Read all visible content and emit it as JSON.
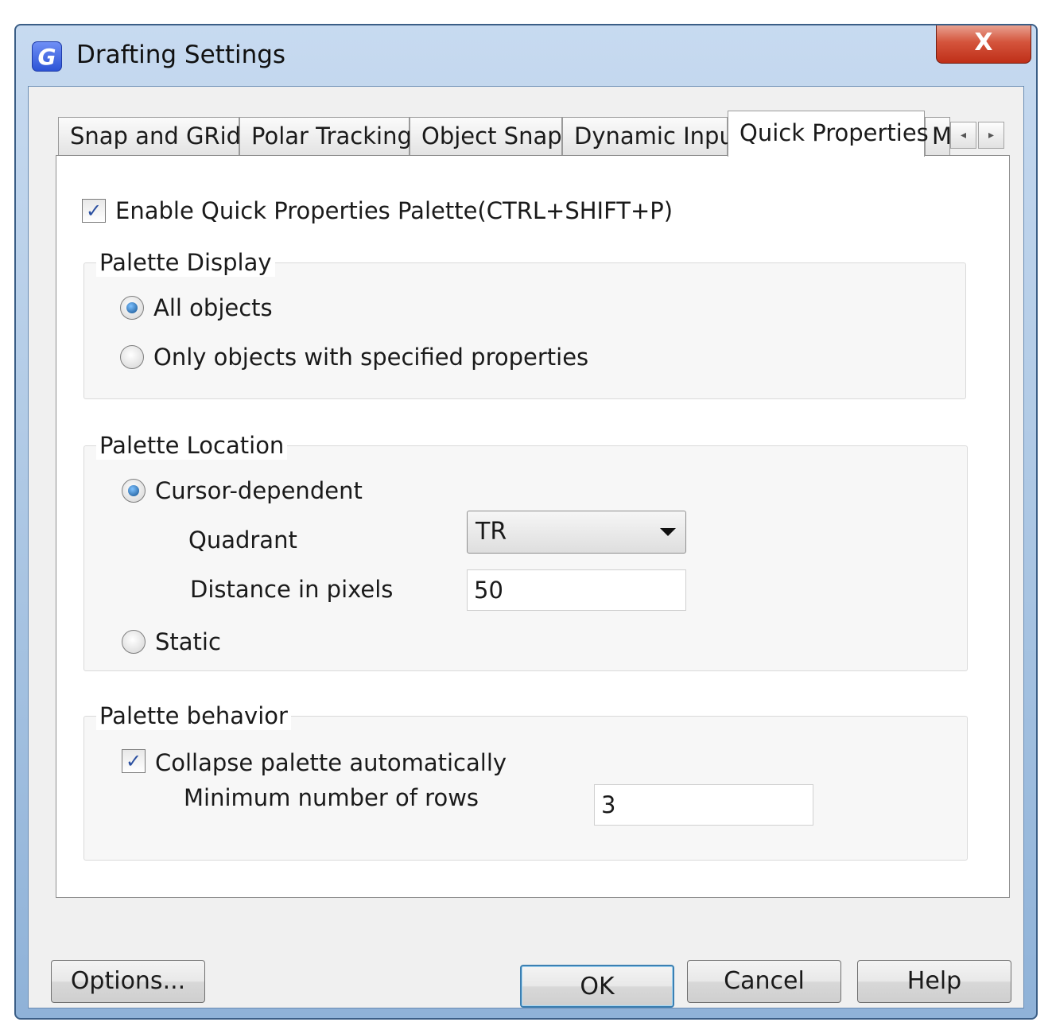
{
  "window": {
    "title": "Drafting Settings",
    "app_icon_letter": "G",
    "close_glyph": "X"
  },
  "tabs": [
    {
      "label": "Snap and GRid",
      "active": false
    },
    {
      "label": "Polar Tracking",
      "active": false
    },
    {
      "label": "Object Snap",
      "active": false
    },
    {
      "label": "Dynamic Input",
      "active": false
    },
    {
      "label": "Quick Properties",
      "active": true
    },
    {
      "label": "M",
      "active": false
    }
  ],
  "tab_scroll": {
    "left_glyph": "◂",
    "right_glyph": "▸"
  },
  "enable_palette": {
    "label": "Enable Quick Properties Palette(CTRL+SHIFT+P)",
    "checked": true
  },
  "palette_display": {
    "title": "Palette Display",
    "options": [
      {
        "label": "All objects",
        "selected": true
      },
      {
        "label": "Only objects with specified properties",
        "selected": false
      }
    ]
  },
  "palette_location": {
    "title": "Palette Location",
    "cursor_dependent": {
      "label": "Cursor-dependent",
      "selected": true
    },
    "quadrant": {
      "label": "Quadrant",
      "value": "TR"
    },
    "distance": {
      "label": "Distance in pixels",
      "value": "50"
    },
    "static": {
      "label": "Static",
      "selected": false
    }
  },
  "palette_behavior": {
    "title": "Palette behavior",
    "collapse": {
      "label": "Collapse palette automatically",
      "checked": true
    },
    "min_rows": {
      "label": "Minimum number of rows",
      "value": "3"
    }
  },
  "buttons": {
    "options": "Options...",
    "ok": "OK",
    "cancel": "Cancel",
    "help": "Help"
  },
  "icons": {
    "check_glyph": "✓"
  },
  "colors": {
    "title_bar": "#b2cbe6",
    "close_button": "#d4543c",
    "radio_dot": "#11508f",
    "default_button_border": "#3c7fb1"
  }
}
